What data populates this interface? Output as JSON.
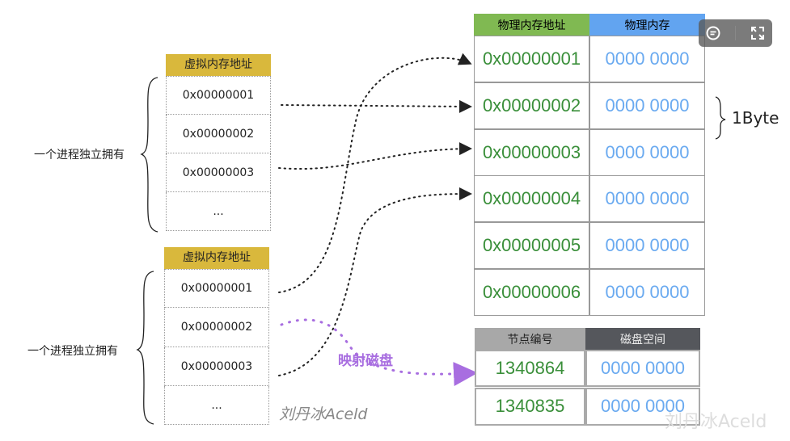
{
  "process_label": "一个进程独立拥有",
  "virtual_tables": [
    {
      "header": "虚拟内存地址",
      "rows": [
        "0x00000001",
        "0x00000002",
        "0x00000003",
        "..."
      ]
    },
    {
      "header": "虚拟内存地址",
      "rows": [
        "0x00000001",
        "0x00000002",
        "0x00000003",
        "..."
      ]
    }
  ],
  "physical_table": {
    "headers": [
      "物理内存地址",
      "物理内存"
    ],
    "rows": [
      [
        "0x00000001",
        "0000 0000"
      ],
      [
        "0x00000002",
        "0000 0000"
      ],
      [
        "0x00000003",
        "0000 0000"
      ],
      [
        "0x00000004",
        "0000 0000"
      ],
      [
        "0x00000005",
        "0000 0000"
      ],
      [
        "0x00000006",
        "0000 0000"
      ]
    ]
  },
  "byte_label": "1Byte",
  "disk_table": {
    "headers": [
      "节点编号",
      "磁盘空间"
    ],
    "rows": [
      [
        "1340864",
        "0000 0000"
      ],
      [
        "1340835",
        "0000 0000"
      ]
    ]
  },
  "mapping_label": "映射磁盘",
  "watermarks": [
    "刘丹冰Aceld",
    "刘丹冰Aceld"
  ],
  "colors": {
    "virtual_header": "#d9b83c",
    "phys_addr_header": "#80b952",
    "phys_mem_header": "#62a4f0",
    "disk_node_header": "#a8a8a8",
    "disk_space_header": "#55575c",
    "address_text": "#3a8f3a",
    "value_text": "#6aaaf0",
    "mapping": "#a86ee0"
  },
  "toolbar": {
    "icons": [
      "comment-icon",
      "fullscreen-icon"
    ]
  }
}
